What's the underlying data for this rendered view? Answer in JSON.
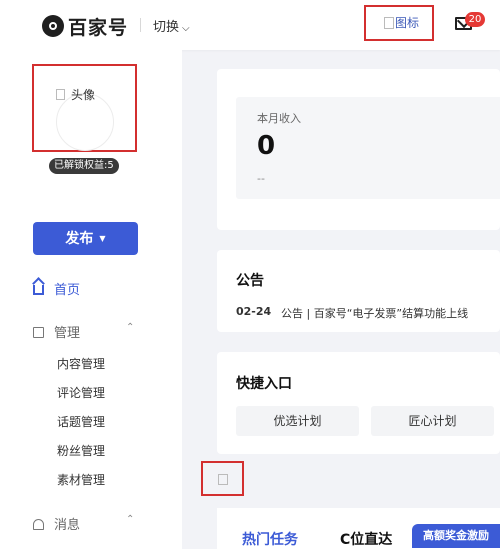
{
  "header": {
    "brand": "百家号",
    "switch_label": "切换",
    "header_image_alt": "图标",
    "mail_badge": "20"
  },
  "sidebar": {
    "avatar_alt": "头像",
    "unlock_badge": "已解锁权益:5",
    "publish_label": "发布",
    "home_label": "首页",
    "manage_label": "管理",
    "manage_items": [
      "内容管理",
      "评论管理",
      "话题管理",
      "粉丝管理",
      "素材管理"
    ],
    "message_label": "消息"
  },
  "main": {
    "income": {
      "label": "本月收入",
      "value": "0",
      "sub": "--"
    },
    "notice": {
      "title": "公告",
      "date": "02-24",
      "text": "公告 | 百家号“电子发票”结算功能上线"
    },
    "shortcuts": {
      "title": "快捷入口",
      "items": [
        "优选计划",
        "匠心计划"
      ]
    },
    "tabs": {
      "hot": "热门任务",
      "c_position": "C位直达",
      "promo": "高额奖金激励"
    }
  },
  "colors": {
    "accent": "#3c5bd6",
    "highlight_border": "#d32f2f",
    "badge_red": "#e53935"
  }
}
